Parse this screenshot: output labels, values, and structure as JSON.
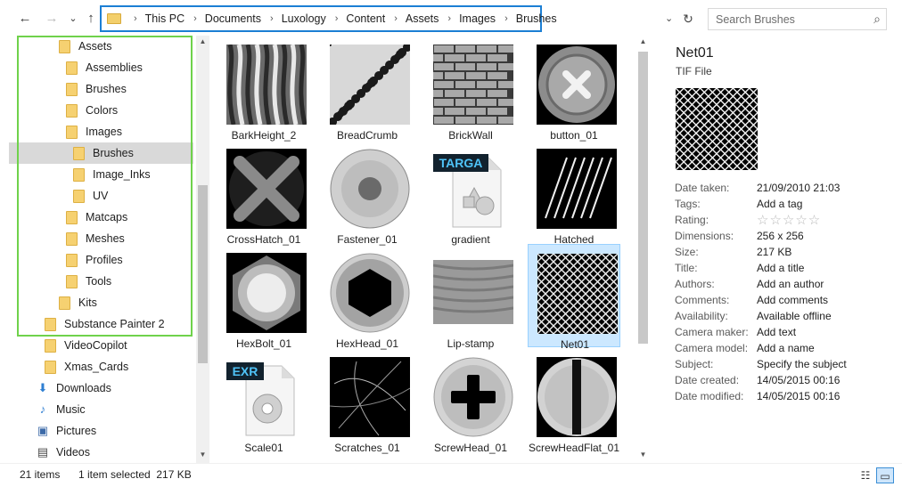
{
  "toolbar": {
    "back_icon": "←",
    "forward_icon": "→",
    "recent_icon": "⌄",
    "up_icon": "↑"
  },
  "address": {
    "crumbs": [
      "This PC",
      "Documents",
      "Luxology",
      "Content",
      "Assets",
      "Images",
      "Brushes"
    ],
    "dropdown_icon": "⌄",
    "refresh_icon": "↻"
  },
  "search": {
    "placeholder": "Search Brushes",
    "icon": "⌕"
  },
  "nav": {
    "items": [
      {
        "label": "Assets",
        "type": "folder"
      },
      {
        "label": "Assemblies",
        "type": "folder"
      },
      {
        "label": "Brushes",
        "type": "folder"
      },
      {
        "label": "Colors",
        "type": "folder"
      },
      {
        "label": "Images",
        "type": "folder"
      },
      {
        "label": "Brushes",
        "type": "folder",
        "selected": true
      },
      {
        "label": "Image_Inks",
        "type": "folder"
      },
      {
        "label": "UV",
        "type": "folder"
      },
      {
        "label": "Matcaps",
        "type": "folder"
      },
      {
        "label": "Meshes",
        "type": "folder"
      },
      {
        "label": "Profiles",
        "type": "folder"
      },
      {
        "label": "Tools",
        "type": "folder"
      },
      {
        "label": "Kits",
        "type": "folder"
      },
      {
        "label": "Substance Painter 2",
        "type": "folder"
      },
      {
        "label": "VideoCopilot",
        "type": "folder"
      },
      {
        "label": "Xmas_Cards",
        "type": "folder"
      },
      {
        "label": "Downloads",
        "type": "downloads-icon"
      },
      {
        "label": "Music",
        "type": "music-icon"
      },
      {
        "label": "Pictures",
        "type": "pictures-icon"
      },
      {
        "label": "Videos",
        "type": "videos-icon"
      }
    ]
  },
  "files": [
    {
      "name": "BarkHeight_2",
      "thumb": "bark"
    },
    {
      "name": "BreadCrumb",
      "thumb": "breadcrumb"
    },
    {
      "name": "BrickWall",
      "thumb": "brickwall"
    },
    {
      "name": "button_01",
      "thumb": "button"
    },
    {
      "name": "CrossHatch_01",
      "thumb": "crosshatch"
    },
    {
      "name": "Fastener_01",
      "thumb": "fastener"
    },
    {
      "name": "gradient",
      "thumb": "targa-file-icon",
      "badge": "TARGA"
    },
    {
      "name": "Hatched",
      "thumb": "hatched"
    },
    {
      "name": "HexBolt_01",
      "thumb": "hexbolt"
    },
    {
      "name": "HexHead_01",
      "thumb": "hexhead"
    },
    {
      "name": "Lip-stamp",
      "thumb": "lipstamp"
    },
    {
      "name": "Net01",
      "thumb": "net",
      "selected": true
    },
    {
      "name": "Scale01",
      "thumb": "exr-file-icon",
      "badge": "EXR"
    },
    {
      "name": "Scratches_01",
      "thumb": "scratches"
    },
    {
      "name": "ScrewHead_01",
      "thumb": "screwhead"
    },
    {
      "name": "ScrewHeadFlat_01",
      "thumb": "screwheadflat"
    }
  ],
  "details": {
    "title": "Net01",
    "type": "TIF File",
    "properties": [
      {
        "key": "Date taken:",
        "value": "21/09/2010 21:03"
      },
      {
        "key": "Tags:",
        "value": "Add a tag"
      },
      {
        "key": "Rating:",
        "value": "☆☆☆☆☆",
        "stars": 0
      },
      {
        "key": "Dimensions:",
        "value": "256 x 256"
      },
      {
        "key": "Size:",
        "value": "217 KB"
      },
      {
        "key": "Title:",
        "value": "Add a title"
      },
      {
        "key": "Authors:",
        "value": "Add an author"
      },
      {
        "key": "Comments:",
        "value": "Add comments"
      },
      {
        "key": "Availability:",
        "value": "Available offline"
      },
      {
        "key": "Camera maker:",
        "value": "Add text"
      },
      {
        "key": "Camera model:",
        "value": "Add a name"
      },
      {
        "key": "Subject:",
        "value": "Specify the subject"
      },
      {
        "key": "Date created:",
        "value": "14/05/2015 00:16"
      },
      {
        "key": "Date modified:",
        "value": "14/05/2015 00:16"
      }
    ]
  },
  "status": {
    "item_count": "21 items",
    "selection": "1 item selected  217 KB"
  },
  "colors": {
    "address_border": "#1c7fd4",
    "nav_highlight_border": "#6fd24b",
    "selection_fill": "#cce8ff"
  }
}
